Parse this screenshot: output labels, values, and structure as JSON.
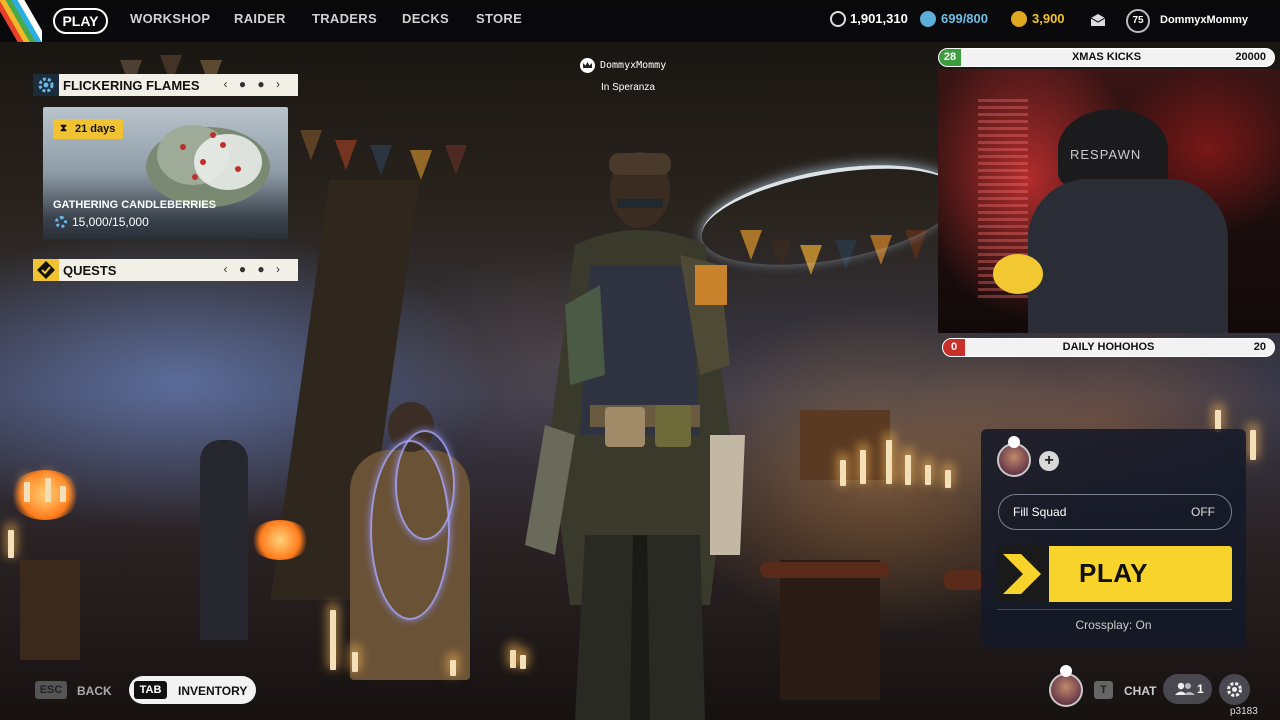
{
  "nav": {
    "items": [
      "PLAY",
      "WORKSHOP",
      "RAIDER",
      "TRADERS",
      "DECKS",
      "STORE"
    ]
  },
  "currencies": {
    "coins": "1,901,310",
    "capacity": "699/800",
    "premium": "3,900"
  },
  "account": {
    "level": "75",
    "username": "DommyxMommy"
  },
  "event_panel": {
    "title": "FLICKERING FLAMES",
    "days_label": "21 days",
    "card_title": "GATHERING CANDLEBERRIES",
    "card_progress": "15,000/15,000"
  },
  "quests_panel": {
    "title": "QUESTS"
  },
  "player_tag": {
    "name": "DommyxMommy",
    "location": "In Speranza"
  },
  "stream_overlay": {
    "challenge1": {
      "left": "28",
      "label": "XMAS KICKS",
      "right": "20000"
    },
    "challenge2": {
      "left": "0",
      "label": "DAILY HOHOHOS",
      "right": "20"
    },
    "webcam_brand": "RESPAWN"
  },
  "squad": {
    "fill_label": "Fill Squad",
    "fill_value": "OFF",
    "play_label": "PLAY",
    "crossplay": "Crossplay: On"
  },
  "bottom": {
    "esc_key": "ESC",
    "back_label": "BACK",
    "tab_key": "TAB",
    "inventory_label": "INVENTORY",
    "chat_key": "T",
    "chat_label": "CHAT",
    "friends_count": "1",
    "corner_text": "p3183"
  },
  "colors": {
    "accent_yellow": "#f8d32b",
    "challenge_green": "#3d9c3d",
    "challenge_red": "#c9302c"
  }
}
